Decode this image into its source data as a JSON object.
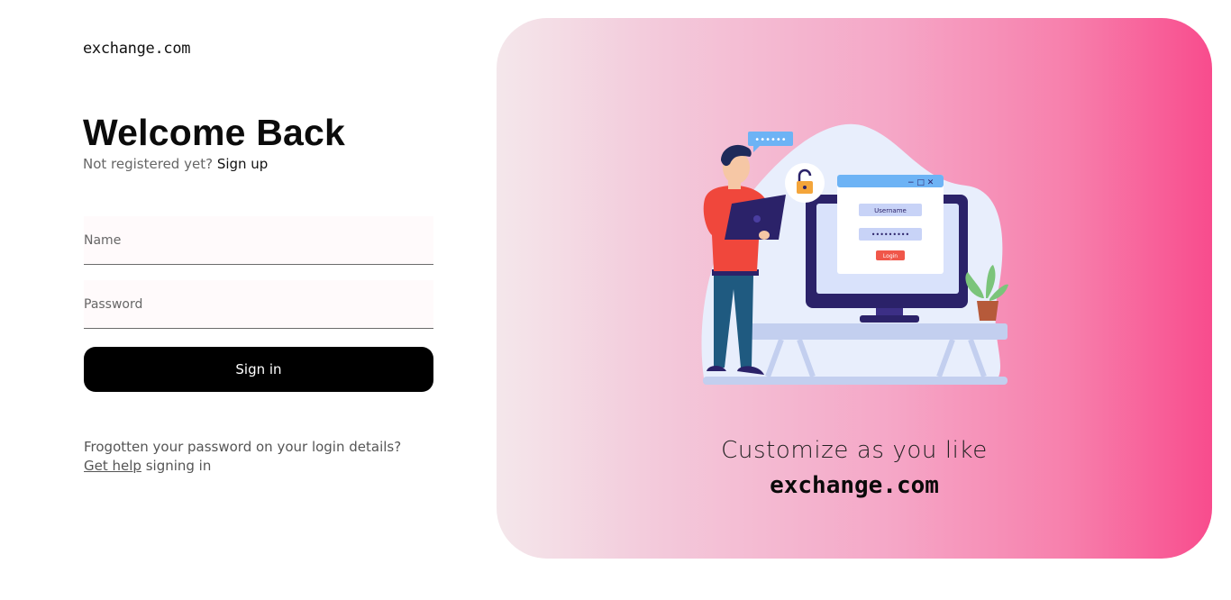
{
  "brand": "exchange.com",
  "heading": "Welcome Back",
  "signup_prompt": "Not registered yet?",
  "signup_link": "Sign up",
  "form": {
    "name_placeholder": "Name",
    "password_placeholder": "Password",
    "submit_label": "Sign in"
  },
  "help": {
    "line1": "Frogotten your password on your login details?",
    "link": "Get help",
    "line2_rest": " signing in"
  },
  "illustration": {
    "speech_bubble": "••••••",
    "username_label": "Username",
    "password_dots": "•••••••••",
    "login_label": "Login"
  },
  "hero": {
    "tagline": "Customize as you like",
    "brand": "exchange.com"
  },
  "colors": {
    "accent_pink": "#f84c8d",
    "button_black": "#000000"
  }
}
